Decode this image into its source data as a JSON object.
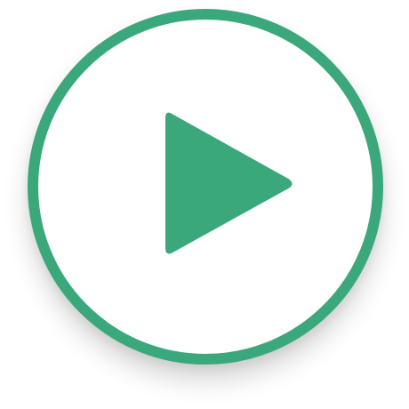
{
  "player": {
    "control": "play",
    "icon": "play-icon",
    "colors": {
      "accent": "#3aa87a",
      "background": "#ffffff"
    }
  }
}
